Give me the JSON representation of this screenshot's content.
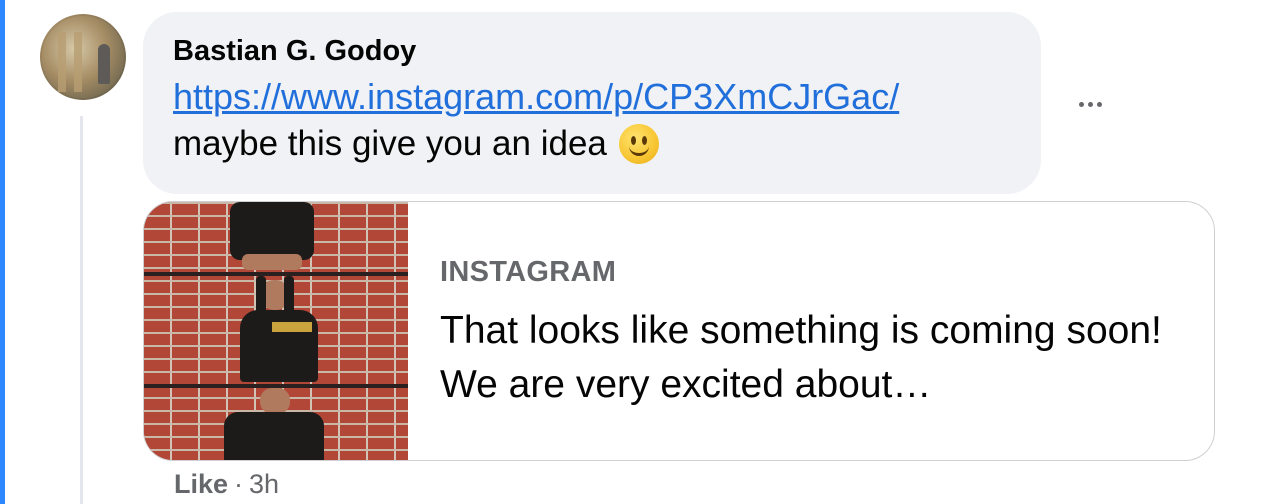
{
  "comment": {
    "author": "Bastian G. Godoy",
    "link": "https://www.instagram.com/p/CP3XmCJrGac/",
    "message": "maybe this give you an idea",
    "emoji": "slightly-smiling-face-emoji"
  },
  "link_preview": {
    "source": "INSTAGRAM",
    "title": "That looks like something is coming soon! We are very excited about…"
  },
  "footer": {
    "like_label": "Like",
    "separator": "·",
    "timestamp": "3h"
  },
  "icons": {
    "more": "more-options-icon"
  },
  "colors": {
    "accent_edge": "#2d88ff",
    "link": "#216fdb",
    "bubble_bg": "#f0f2f5",
    "secondary_text": "#65676b",
    "primary_text": "#050505"
  }
}
